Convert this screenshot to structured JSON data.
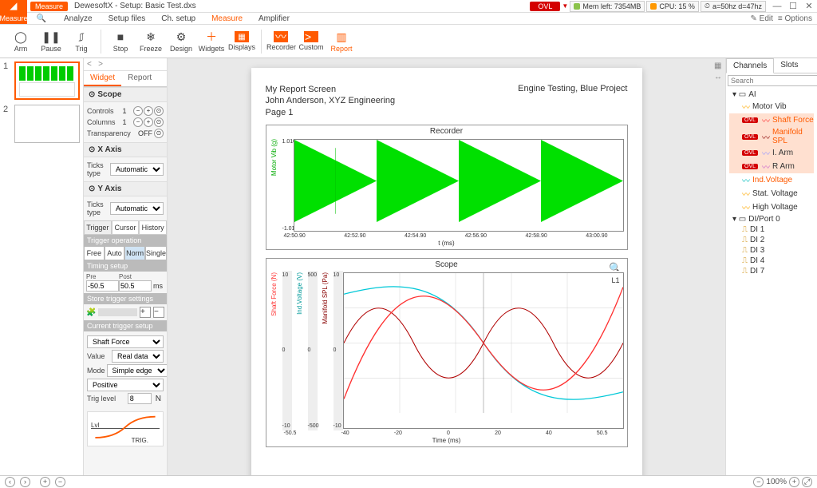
{
  "app": {
    "title": "DewesoftX - Setup: Basic Test.dxs"
  },
  "titlebar": {
    "measure_badge": "Measure",
    "ovl": "OVL",
    "mem": "Mem left: 7354MB",
    "cpu": "CPU: 15 %",
    "clock": "a=50hz d=47hz"
  },
  "menubar": {
    "items": [
      "Measure",
      "Analyze",
      "Setup files",
      "Ch. setup",
      "Measure",
      "Amplifier"
    ],
    "edit": "Edit",
    "options": "Options"
  },
  "toolbar": {
    "arm": "Arm",
    "pause": "Pause",
    "trig": "Trig",
    "stop": "Stop",
    "freeze": "Freeze",
    "design": "Design",
    "widgets": "Widgets",
    "displays": "Displays",
    "recorder": "Recorder",
    "custom": "Custom",
    "report": "Report"
  },
  "thumbs": {
    "n1": "1",
    "n2": "2"
  },
  "prop_tabs": {
    "widget": "Widget",
    "report": "Report"
  },
  "scope_sect": {
    "title": "Scope",
    "controls_label": "Controls",
    "controls_val": "1",
    "columns_label": "Columns",
    "columns_val": "1",
    "transparency_label": "Transparency",
    "transparency_val": "OFF"
  },
  "xaxis": {
    "title": "X Axis",
    "ticks_label": "Ticks type",
    "ticks_val": "Automatic"
  },
  "yaxis": {
    "title": "Y Axis",
    "ticks_label": "Ticks type",
    "ticks_val": "Automatic"
  },
  "trig_tabs": {
    "trigger": "Trigger",
    "cursor": "Cursor",
    "history": "History"
  },
  "trig": {
    "op_title": "Trigger operation",
    "free": "Free",
    "auto": "Auto",
    "norm": "Norm",
    "single": "Single",
    "timing_title": "Timing setup",
    "pre_label": "Pre",
    "pre_val": "-50.5",
    "post_label": "Post",
    "post_val": "50.5",
    "ms": "ms",
    "store_title": "Store trigger settings",
    "current_title": "Current trigger setup",
    "ch_val": "Shaft Force",
    "value_label": "Value",
    "value_val": "Real data",
    "mode_label": "Mode",
    "mode_val": "Simple edge",
    "slope_val": "Positive",
    "level_label": "Trig level",
    "level_val": "8",
    "level_unit": "N",
    "lvl": "Lvl",
    "trig_lbl": "TRIG."
  },
  "page": {
    "title": "My Report Screen",
    "author": "John Anderson, XYZ Engineering",
    "pageno": "Page 1",
    "project": "Engine Testing, Blue Project"
  },
  "chart_data": [
    {
      "type": "line",
      "title": "Recorder",
      "xlabel": "t (ms)",
      "ylabel": "Motor Vib (g)",
      "xlim": [
        "42:50.90",
        "43:00.90"
      ],
      "ylim": [
        -1.0107,
        1.0107
      ],
      "x_ticks": [
        "42:50.90",
        "42:52.90",
        "42:54.90",
        "42:56.90",
        "42:58.90",
        "43:00.90"
      ],
      "series": [
        {
          "name": "Motor Vib",
          "color": "#00e000",
          "note": "four repeating high-density bursts filling full y-range"
        }
      ]
    },
    {
      "type": "line",
      "title": "Scope",
      "xlabel": "Time (ms)",
      "xlim": [
        -50.5,
        50.5
      ],
      "x_ticks": [
        -50.5,
        -40,
        -20,
        0,
        20,
        40,
        50.5
      ],
      "series": [
        {
          "name": "Shaft Force",
          "color": "#ff3030",
          "ylabel": "Shaft Force (N)",
          "ylim": [
            -10.0,
            10.0
          ],
          "note": "≈1.5 cycles sine, amplitude ~10"
        },
        {
          "name": "Ind.Voltage",
          "color": "#00c8d8",
          "ylabel": "Ind.Voltage (V)",
          "ylim": [
            -500.0,
            500.0
          ],
          "note": "slow half-sine sweep"
        },
        {
          "name": "Manifold SPL",
          "color": "#b00000",
          "ylabel": "Manifold SPL (Pa)",
          "ylim": [
            -10.0,
            10.0
          ],
          "note": "higher-freq sine, amplitude ~4"
        }
      ],
      "annotations": [
        "L1"
      ]
    }
  ],
  "channels": {
    "tab_channels": "Channels",
    "tab_slots": "Slots",
    "search_ph": "Search",
    "groups": {
      "ai": "AI",
      "diport": "DI/Port 0"
    },
    "items": {
      "motor_vib": "Motor Vib",
      "shaft_force": "Shaft Force",
      "manifold_spl": "Manifold SPL",
      "i_arm": "I. Arm",
      "r_arm": "R Arm",
      "ind_voltage": "Ind.Voltage",
      "stat_voltage": "Stat. Voltage",
      "high_voltage": "High Voltage",
      "di1": "DI 1",
      "di2": "DI 2",
      "di3": "DI 3",
      "di4": "DI 4",
      "di7": "DI 7"
    }
  },
  "footer": {
    "zoom": "100%"
  }
}
